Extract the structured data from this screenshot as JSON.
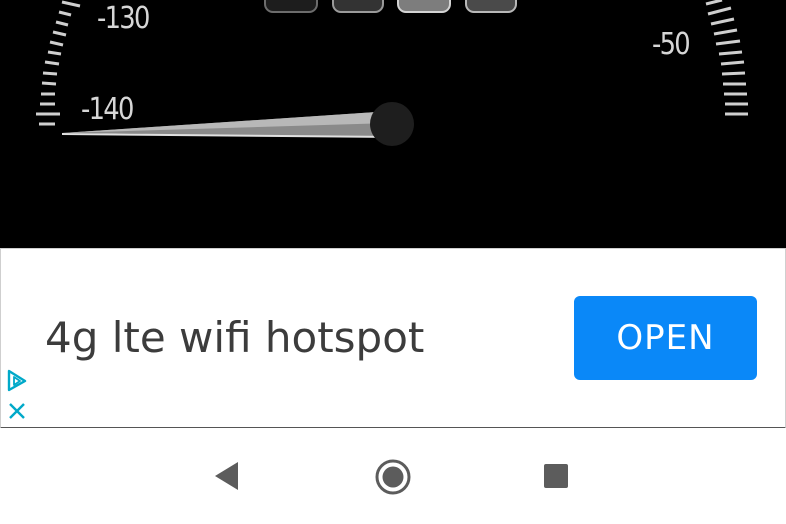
{
  "gauge": {
    "scale_labels": [
      "-130",
      "-140",
      "-50"
    ],
    "needle_value": -140
  },
  "ad": {
    "title": "4g lte wifi hotspot",
    "button_label": "OPEN",
    "accent_color": "#0a88f8",
    "adchoices_color": "#00a9c9"
  },
  "navigation": {
    "back": "back-icon",
    "home": "home-icon",
    "recents": "recents-icon"
  }
}
